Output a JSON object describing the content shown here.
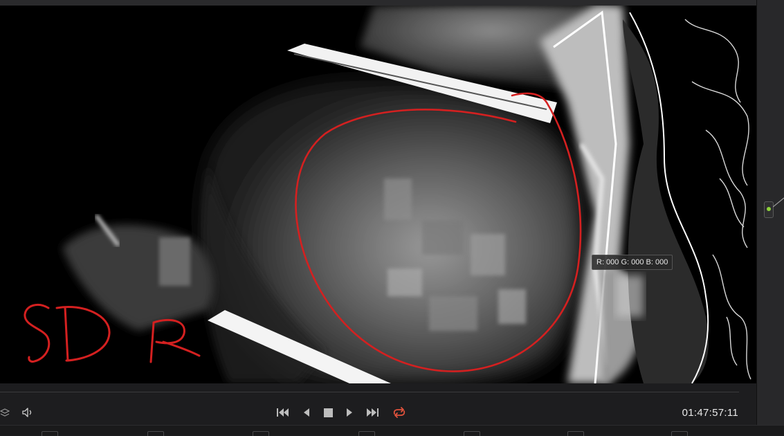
{
  "viewer": {
    "pixel_readout": "R: 000 G: 000 B: 000",
    "annotation_text": "SDR",
    "annotation_color": "#d42020"
  },
  "transport": {
    "timecode": "01:47:57:11",
    "loop_active_color": "#e0523c",
    "icons": [
      "layers-icon",
      "speaker-icon",
      "skip-to-start-icon",
      "step-back-icon",
      "stop-icon",
      "play-icon",
      "skip-to-end-icon",
      "loop-icon"
    ]
  },
  "node_panel": {
    "node_dot_color": "#8fd43a"
  }
}
